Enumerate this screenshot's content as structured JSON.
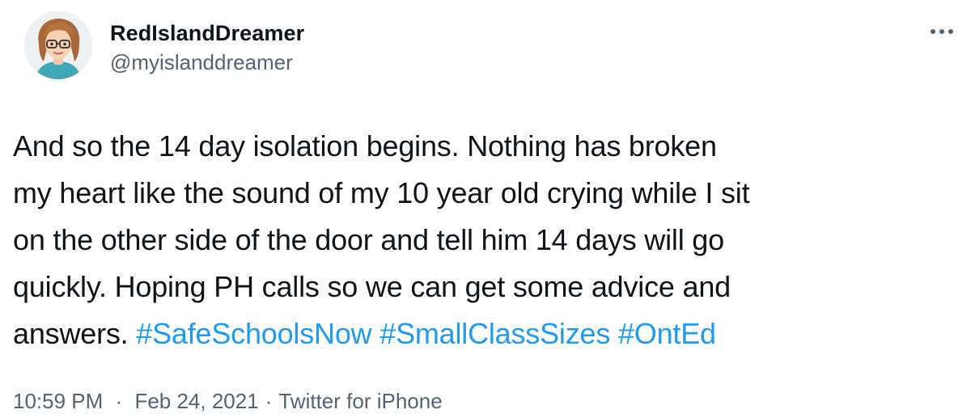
{
  "tweet": {
    "author": {
      "display_name": "RedIslandDreamer",
      "handle": "@myislanddreamer",
      "avatar_icon": "memoji-avatar"
    },
    "more_icon": "more-horizontal-icon",
    "text_lines": {
      "line1": "And so the 14 day isolation begins. Nothing has broken",
      "line2": "my heart like the sound of my 10 year old crying while I sit",
      "line3": "on the other side of the door and tell him 14 days will go",
      "line4": "quickly. Hoping PH calls so we can get some advice and",
      "line5_prefix": "answers."
    },
    "hashtags": [
      "#SafeSchoolsNow",
      "#SmallClassSizes",
      "#OntEd"
    ],
    "time": "10:59 PM",
    "date": "Feb 24, 2021",
    "separator": "·",
    "source": "Twitter for iPhone"
  },
  "colors": {
    "text": "#0f1419",
    "secondary": "#536471",
    "link": "#1d9bf0"
  }
}
